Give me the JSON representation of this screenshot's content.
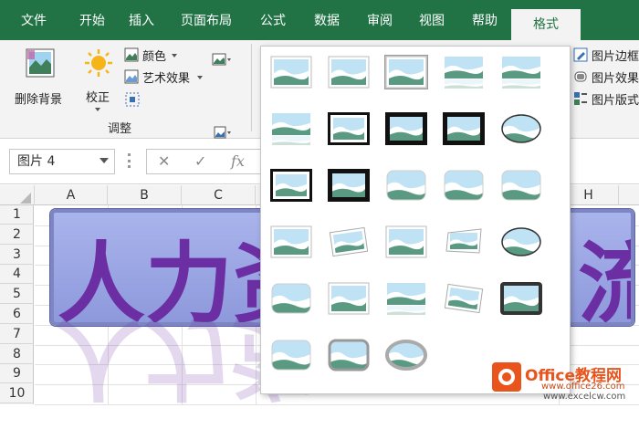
{
  "tabs": [
    {
      "label": "文件",
      "name": "tab-file"
    },
    {
      "label": "开始",
      "name": "tab-home"
    },
    {
      "label": "插入",
      "name": "tab-insert"
    },
    {
      "label": "页面布局",
      "name": "tab-page-layout"
    },
    {
      "label": "公式",
      "name": "tab-formulas"
    },
    {
      "label": "数据",
      "name": "tab-data"
    },
    {
      "label": "审阅",
      "name": "tab-review"
    },
    {
      "label": "视图",
      "name": "tab-view"
    },
    {
      "label": "帮助",
      "name": "tab-help"
    },
    {
      "label": "格式",
      "name": "tab-format"
    }
  ],
  "ribbon": {
    "remove_bg": "删除背景",
    "correct": "校正",
    "color": "颜色",
    "artistic": "艺术效果",
    "group_adjust": "调整",
    "pic_border": "图片边框",
    "pic_effects": "图片效果",
    "pic_layout": "图片版式"
  },
  "formula_bar": {
    "name_box": "图片 4",
    "fx": "fx"
  },
  "columns": [
    "A",
    "B",
    "C",
    "H"
  ],
  "rows": [
    "1",
    "2",
    "3",
    "4",
    "5",
    "6",
    "7",
    "8",
    "9",
    "10"
  ],
  "banner_text": {
    "left": "人力资",
    "right": "流"
  },
  "watermark": {
    "brand": "Office教程网",
    "url": "www.office26.com",
    "url2": "www.excelcw.com"
  },
  "colors": {
    "excel_green": "#217346",
    "banner_purple": "#6b2fa3",
    "banner_bg": "#a9b4ec"
  }
}
